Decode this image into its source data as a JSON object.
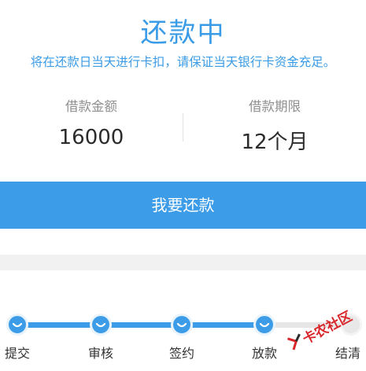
{
  "header": {
    "status_title": "还款中",
    "notice": "将在还款日当天进行卡扣，请保证当天银行卡资金充足。"
  },
  "loan_info": {
    "amount_label": "借款金额",
    "amount_value": "16000",
    "term_label": "借款期限",
    "term_value": "12个月"
  },
  "actions": {
    "repay_label": "我要还款"
  },
  "progress": {
    "steps": [
      {
        "label": "提交",
        "done": true
      },
      {
        "label": "审核",
        "done": true
      },
      {
        "label": "签约",
        "done": true
      },
      {
        "label": "放款",
        "done": true
      },
      {
        "label": "结清",
        "done": false
      }
    ]
  },
  "watermark": {
    "text": "卡农社区"
  },
  "colors": {
    "accent": "#3c9ce8",
    "pending": "#e6e6e6",
    "watermark": "#d9262b"
  }
}
